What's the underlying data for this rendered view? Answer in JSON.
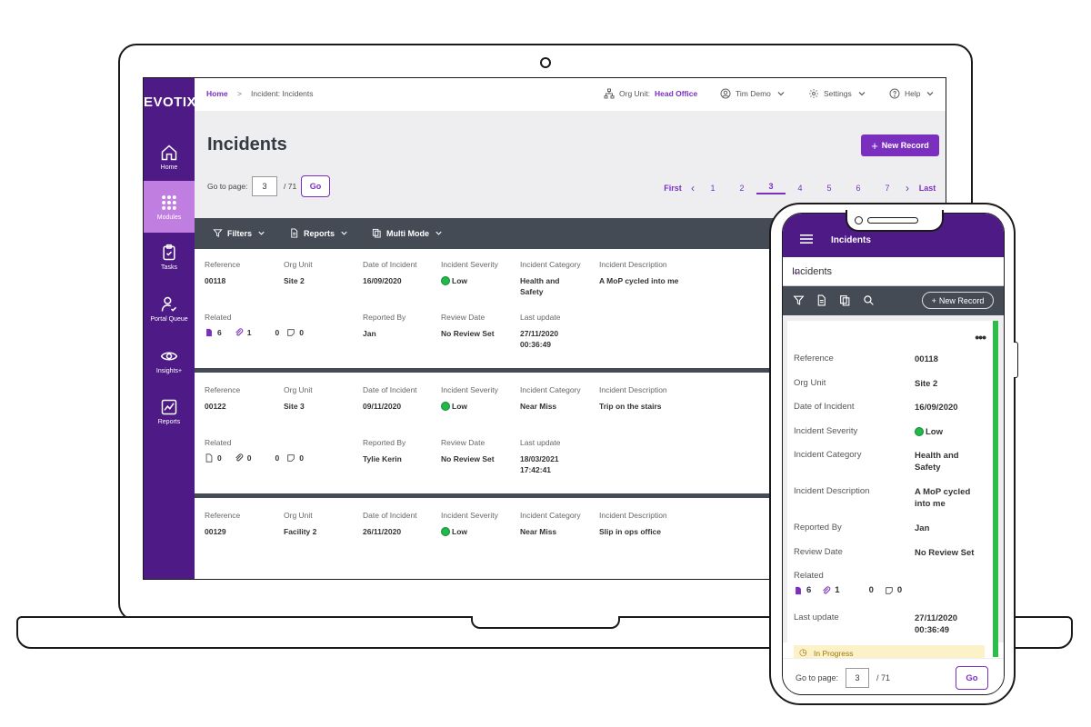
{
  "app": {
    "logo": "EVOTIX"
  },
  "sidebar": {
    "items": [
      {
        "label": "Home",
        "icon": "home-icon"
      },
      {
        "label": "Modules",
        "icon": "grid-icon",
        "active": true
      },
      {
        "label": "Tasks",
        "icon": "clipboard-icon"
      },
      {
        "label": "Portal Queue",
        "icon": "user-check-icon"
      },
      {
        "label": "Insights+",
        "icon": "eye-icon"
      },
      {
        "label": "Reports",
        "icon": "chart-icon"
      }
    ]
  },
  "topbar": {
    "breadcrumb_home": "Home",
    "breadcrumb_sep": ">",
    "breadcrumb_current": "Incident: Incidents",
    "org_unit_label": "Org Unit:",
    "org_unit_value": "Head Office",
    "user": "Tim Demo",
    "settings": "Settings",
    "help": "Help"
  },
  "page": {
    "title": "Incidents",
    "new_record": "New Record",
    "goto_label": "Go to page:",
    "goto_value": "3",
    "goto_total": "/ 71",
    "go": "Go"
  },
  "pager": {
    "first": "First",
    "last": "Last",
    "pages": [
      "1",
      "2",
      "3",
      "4",
      "5",
      "6",
      "7"
    ],
    "current": "3"
  },
  "toolbar": {
    "filters": "Filters",
    "reports": "Reports",
    "multi_mode": "Multi Mode"
  },
  "labels": {
    "reference": "Reference",
    "org_unit": "Org Unit",
    "date": "Date of Incident",
    "severity": "Incident Severity",
    "category": "Incident Category",
    "description": "Incident Description",
    "related": "Related",
    "reported_by": "Reported By",
    "review_date": "Review Date",
    "last_update": "Last update"
  },
  "records": [
    {
      "reference": "00118",
      "org_unit": "Site 2",
      "date": "16/09/2020",
      "severity": "Low",
      "category_1": "Health and",
      "category_2": "Safety",
      "description": "A MoP cycled into me",
      "related_docs": "6",
      "related_attach": "1",
      "related_links": "0",
      "related_notes": "0",
      "reported_by": "Jan",
      "review_date": "No Review Set",
      "last_update_1": "27/11/2020",
      "last_update_2": "00:36:49"
    },
    {
      "reference": "00122",
      "org_unit": "Site 3",
      "date": "09/11/2020",
      "severity": "Low",
      "category_1": "Near Miss",
      "category_2": "",
      "description": "Trip on the stairs",
      "related_docs": "0",
      "related_attach": "0",
      "related_links": "0",
      "related_notes": "0",
      "reported_by": "Tylie Kerin",
      "review_date": "No Review Set",
      "last_update_1": "18/03/2021",
      "last_update_2": "17:42:41"
    },
    {
      "reference": "00129",
      "org_unit": "Facility 2",
      "date": "26/11/2020",
      "severity": "Low",
      "category_1": "Near Miss",
      "category_2": "",
      "description": "Slip in ops office"
    }
  ],
  "phone": {
    "title": "Incidents",
    "select_value": "Incidents",
    "new_record": "New Record",
    "more": "•••",
    "fields": {
      "reference": "00118",
      "org_unit": "Site 2",
      "date": "16/09/2020",
      "severity": "Low",
      "category_1": "Health and",
      "category_2": "Safety",
      "description_1": "A MoP cycled",
      "description_2": "into me",
      "reported_by": "Jan",
      "review_date": "No Review Set",
      "related_docs": "6",
      "related_attach": "1",
      "related_links": "0",
      "related_notes": "0",
      "last_update_1": "27/11/2020",
      "last_update_2": "00:36:49"
    },
    "status": "In Progress",
    "goto_label": "Go to page:",
    "goto_value": "3",
    "goto_total": "/ 71",
    "go": "Go"
  },
  "colors": {
    "brand": "#4d1a86",
    "accent": "#7a2fbf",
    "severity_low": "#22b84a",
    "toolbar": "#444b55"
  }
}
